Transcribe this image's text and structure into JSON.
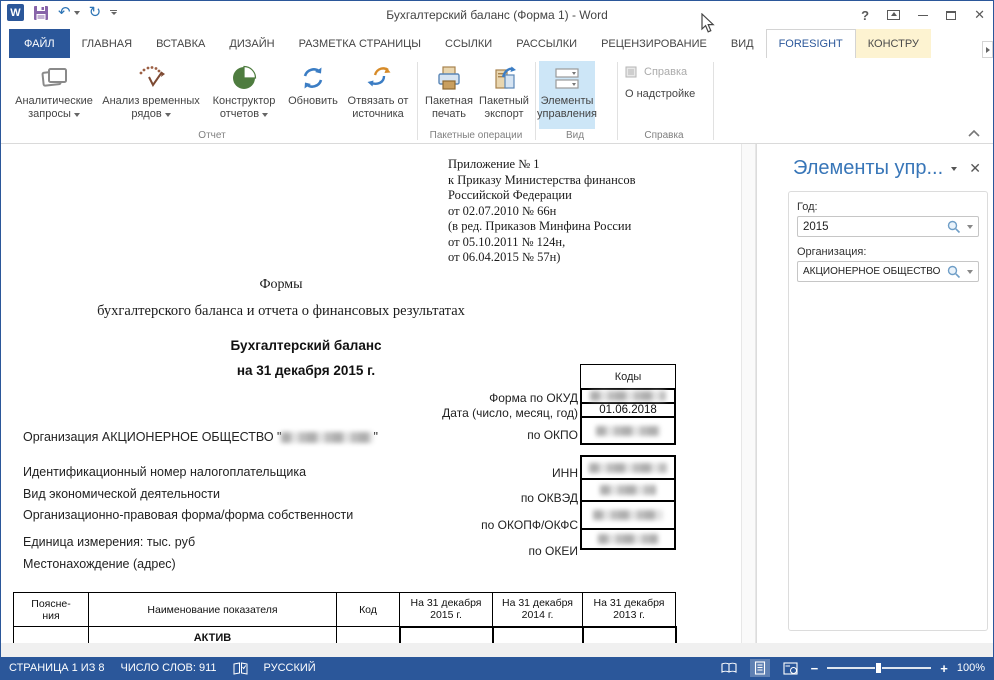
{
  "window": {
    "title": "Бухгалтерский баланс (Форма 1) - Word",
    "controls": {
      "help": "?",
      "close": "✕"
    }
  },
  "icons": {
    "undo": "↶",
    "redo": "↻"
  },
  "tabs": [
    {
      "label": "ФАЙЛ"
    },
    {
      "label": "ГЛАВНАЯ"
    },
    {
      "label": "ВСТАВКА"
    },
    {
      "label": "ДИЗАЙН"
    },
    {
      "label": "РАЗМЕТКА СТРАНИЦЫ"
    },
    {
      "label": "ССЫЛКИ"
    },
    {
      "label": "РАССЫЛКИ"
    },
    {
      "label": "РЕЦЕНЗИРОВАНИЕ"
    },
    {
      "label": "ВИД"
    },
    {
      "label": "FORESIGHT"
    },
    {
      "label": "КОНСТРУ"
    }
  ],
  "ribbon": {
    "groups": [
      {
        "label": "Отчет"
      },
      {
        "label": "Пакетные операции"
      },
      {
        "label": "Вид"
      },
      {
        "label": "Справка"
      }
    ],
    "buttons": {
      "analytic_queries": {
        "line1": "Аналитические",
        "line2": "запросы",
        "icon": "analytic-queries-icon"
      },
      "time_series": {
        "line1": "Анализ временных",
        "line2": "рядов",
        "icon": "time-series-icon"
      },
      "report_designer": {
        "line1": "Конструктор",
        "line2": "отчетов",
        "icon": "report-designer-icon"
      },
      "refresh": {
        "line1": "Обновить",
        "icon": "refresh-icon"
      },
      "unbind": {
        "line1": "Отвязать от",
        "line2": "источника",
        "icon": "unlink-icon"
      },
      "batch_print": {
        "line1": "Пакетная",
        "line2": "печать",
        "icon": "batch-print-icon"
      },
      "batch_export": {
        "line1": "Пакетный",
        "line2": "экспорт",
        "icon": "batch-export-icon"
      },
      "controls": {
        "line1": "Элементы",
        "line2": "управления",
        "icon": "controls-icon"
      },
      "help": {
        "label": "Справка",
        "icon": "help-book-icon"
      },
      "about": {
        "label": "О надстройке"
      }
    }
  },
  "panel": {
    "title": "Элементы упр...",
    "close_glyph": "✕",
    "year_label": "Год:",
    "year_value": "2015",
    "org_label": "Организация:",
    "org_value": "АКЦИОНЕРНОЕ ОБЩЕСТВО"
  },
  "document": {
    "annex_lines": [
      "Приложение № 1",
      "к Приказу Министерства финансов",
      "Российской Федерации",
      "от 02.07.2010 № 66н",
      "(в ред. Приказов Минфина России",
      "от 05.10.2011 № 124н,",
      "от 06.04.2015 № 57н)"
    ],
    "forms_line1": "Формы",
    "forms_line2": "бухгалтерского баланса и отчета о финансовых результатах",
    "title": "Бухгалтерский баланс",
    "subtitle": "на 31 декабря 2015 г.",
    "codes_header": "Коды",
    "date_value": "01.06.2018",
    "right_labels": [
      "Форма по ОКУД",
      "Дата (число, месяц, год)",
      "по ОКПО",
      "ИНН",
      "по ОКВЭД",
      "по ОКОПФ/ОКФС",
      "по ОКЕИ"
    ],
    "org_prefix": "Организация АКЦИОНЕРНОЕ ОБЩЕСТВО \"",
    "org_suffix": "\"",
    "left_labels": [
      "Идентификационный номер налогоплательщика",
      "Вид экономической деятельности",
      "Организационно-правовая форма/форма собственности",
      "Единица измерения: тыс. руб",
      "Местонахождение (адрес)"
    ],
    "table": {
      "col1_line1": "Поясне-",
      "col1_line2": "ния",
      "col2": "Наименование показателя",
      "col3": "Код",
      "col4_line1": "На 31 декабря",
      "col4_line2": "2015 г.",
      "col5_line1": "На 31 декабря",
      "col5_line2": "2014 г.",
      "col6_line1": "На 31 декабря",
      "col6_line2": "2013 г.",
      "row1": "АКТИВ"
    }
  },
  "status_bar": {
    "page": "СТРАНИЦА 1 ИЗ 8",
    "words": "ЧИСЛО СЛОВ: 911",
    "language": "РУССКИЙ",
    "zoom_out": "−",
    "zoom_in": "+",
    "zoom": "100%"
  },
  "colors": {
    "accent": "#2B579A",
    "ribbon_highlight": "#CDE6F7",
    "context_tab": "#FDF3D1"
  }
}
